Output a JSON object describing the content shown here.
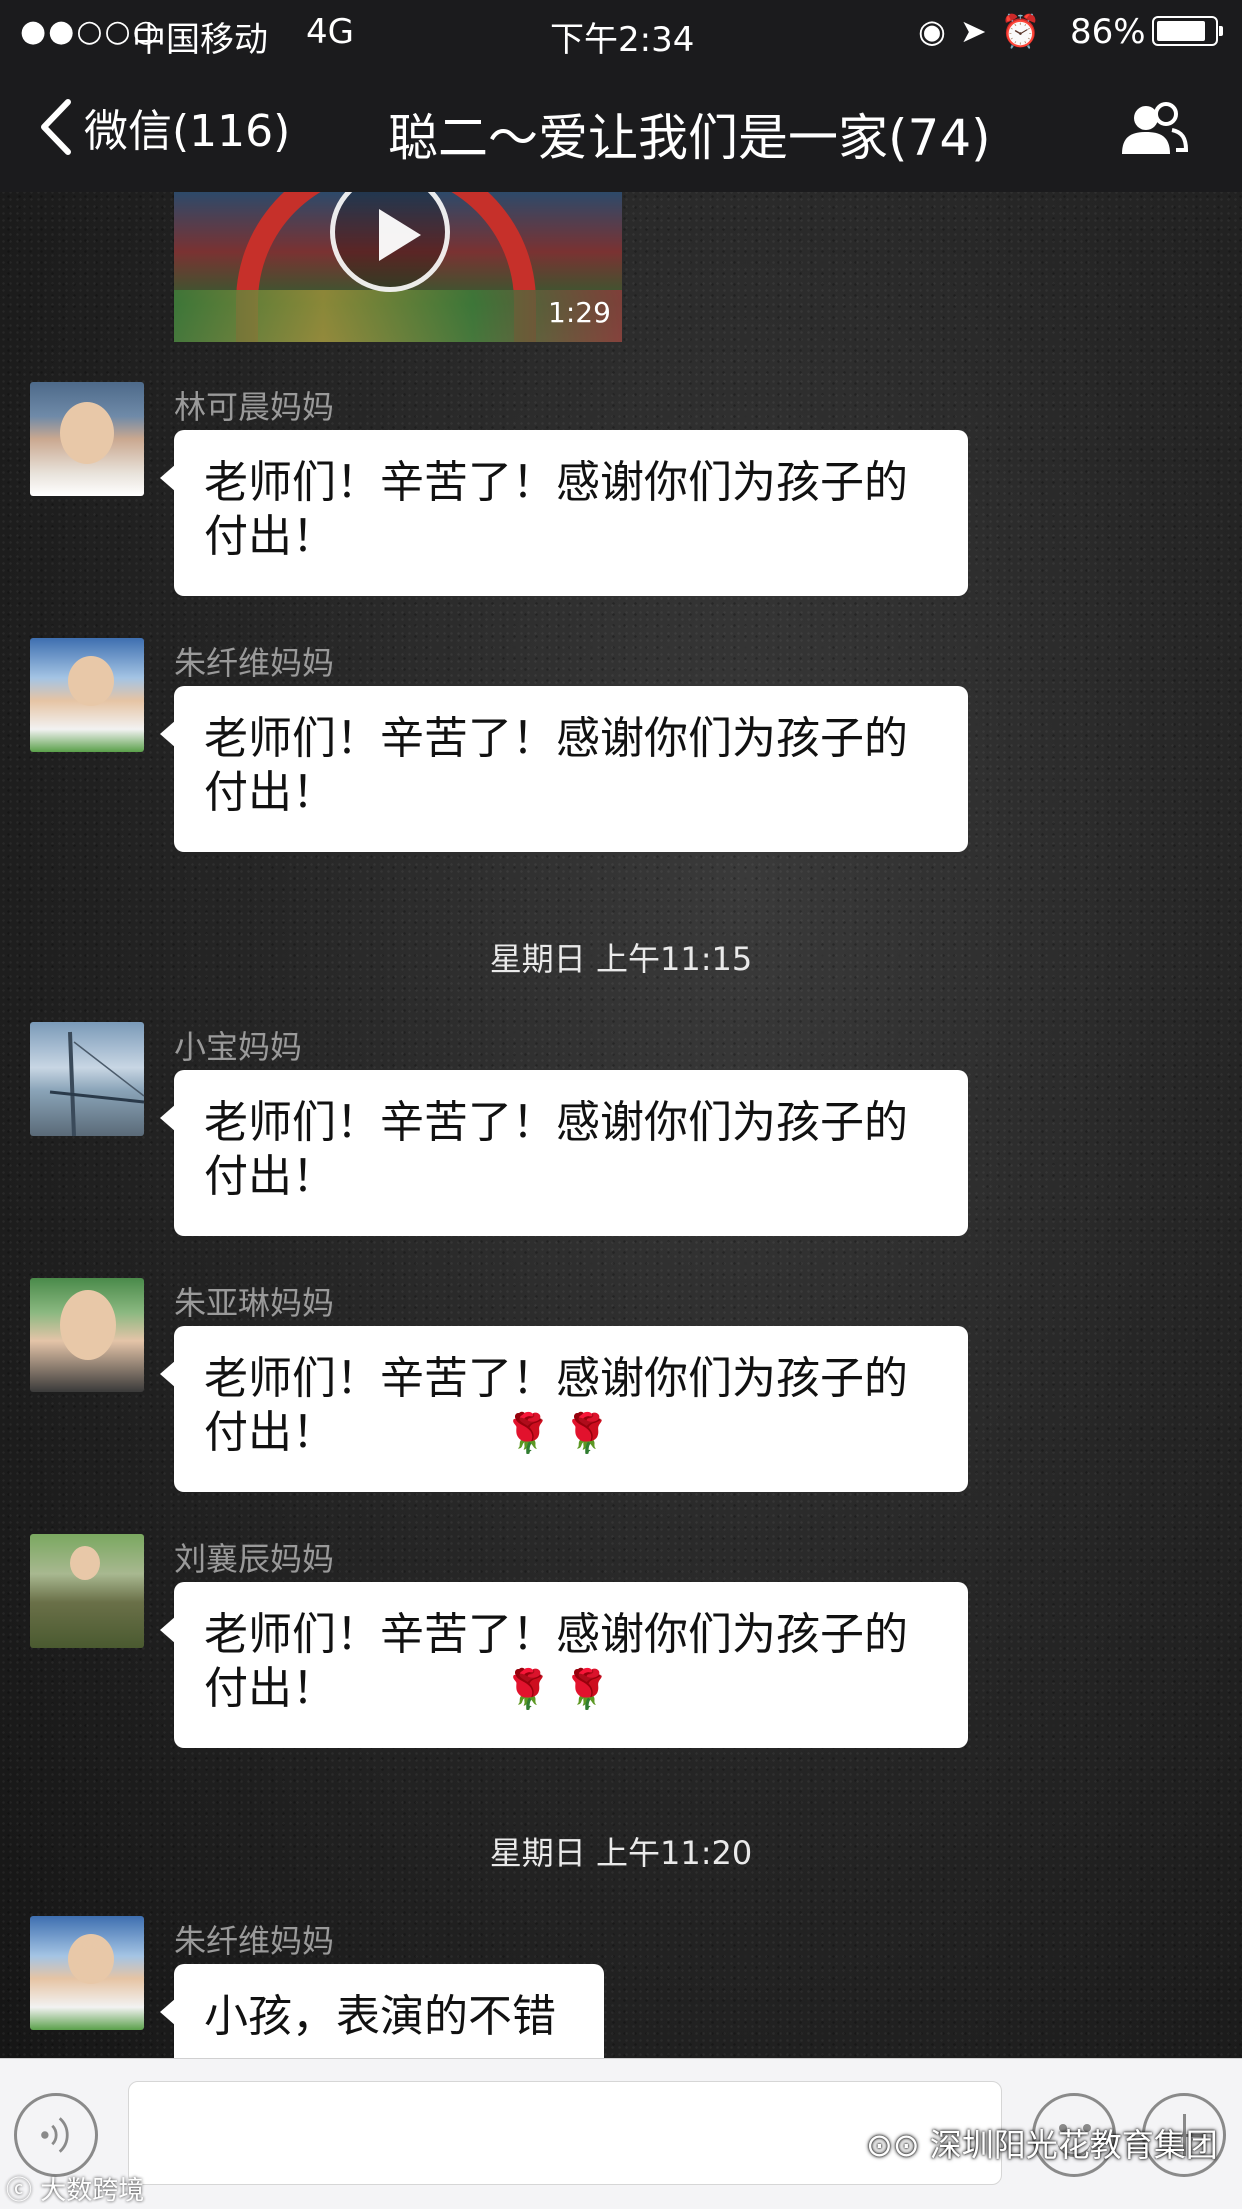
{
  "status_bar": {
    "signal": "●●○○○",
    "carrier": "中国移动",
    "network": "4G",
    "time": "下午2:34",
    "status_icons": "◉➤⏰",
    "battery_percent": "86%",
    "battery_level": 0.86
  },
  "nav": {
    "back_label": "微信(116)",
    "title": "聪二～爱让我们是一家(74)"
  },
  "video": {
    "duration": "1:29"
  },
  "messages": [
    {
      "sender": "林可晨妈妈",
      "text": "老师们！辛苦了！感谢你们为孩子的\n付出！",
      "roses": ""
    },
    {
      "sender": "朱纤维妈妈",
      "text": "老师们！辛苦了！感谢你们为孩子的\n付出！",
      "roses": ""
    },
    {
      "sender": "小宝妈妈",
      "text": "老师们！辛苦了！感谢你们为孩子的\n付出！",
      "roses": ""
    },
    {
      "sender": "朱亚琳妈妈",
      "text": "老师们！辛苦了！感谢你们为孩子的\n付出！",
      "roses": "🌹 🌹"
    },
    {
      "sender": "刘襄辰妈妈",
      "text": "老师们！辛苦了！感谢你们为孩子的\n付出！",
      "roses": "🌹 🌹"
    },
    {
      "sender": "朱纤维妈妈",
      "text": "小孩，表演的不错",
      "roses": ""
    }
  ],
  "timestamps": [
    "星期日 上午11:15",
    "星期日 上午11:20"
  ],
  "watermarks": {
    "right": "深圳阳光花教育集团",
    "left": "大数跨境"
  },
  "colors": {
    "bar_bg": "#1b1b1d",
    "bubble": "#ffffff",
    "sender_name": "#9a9a9a",
    "input_bar": "#f4f4f6"
  }
}
